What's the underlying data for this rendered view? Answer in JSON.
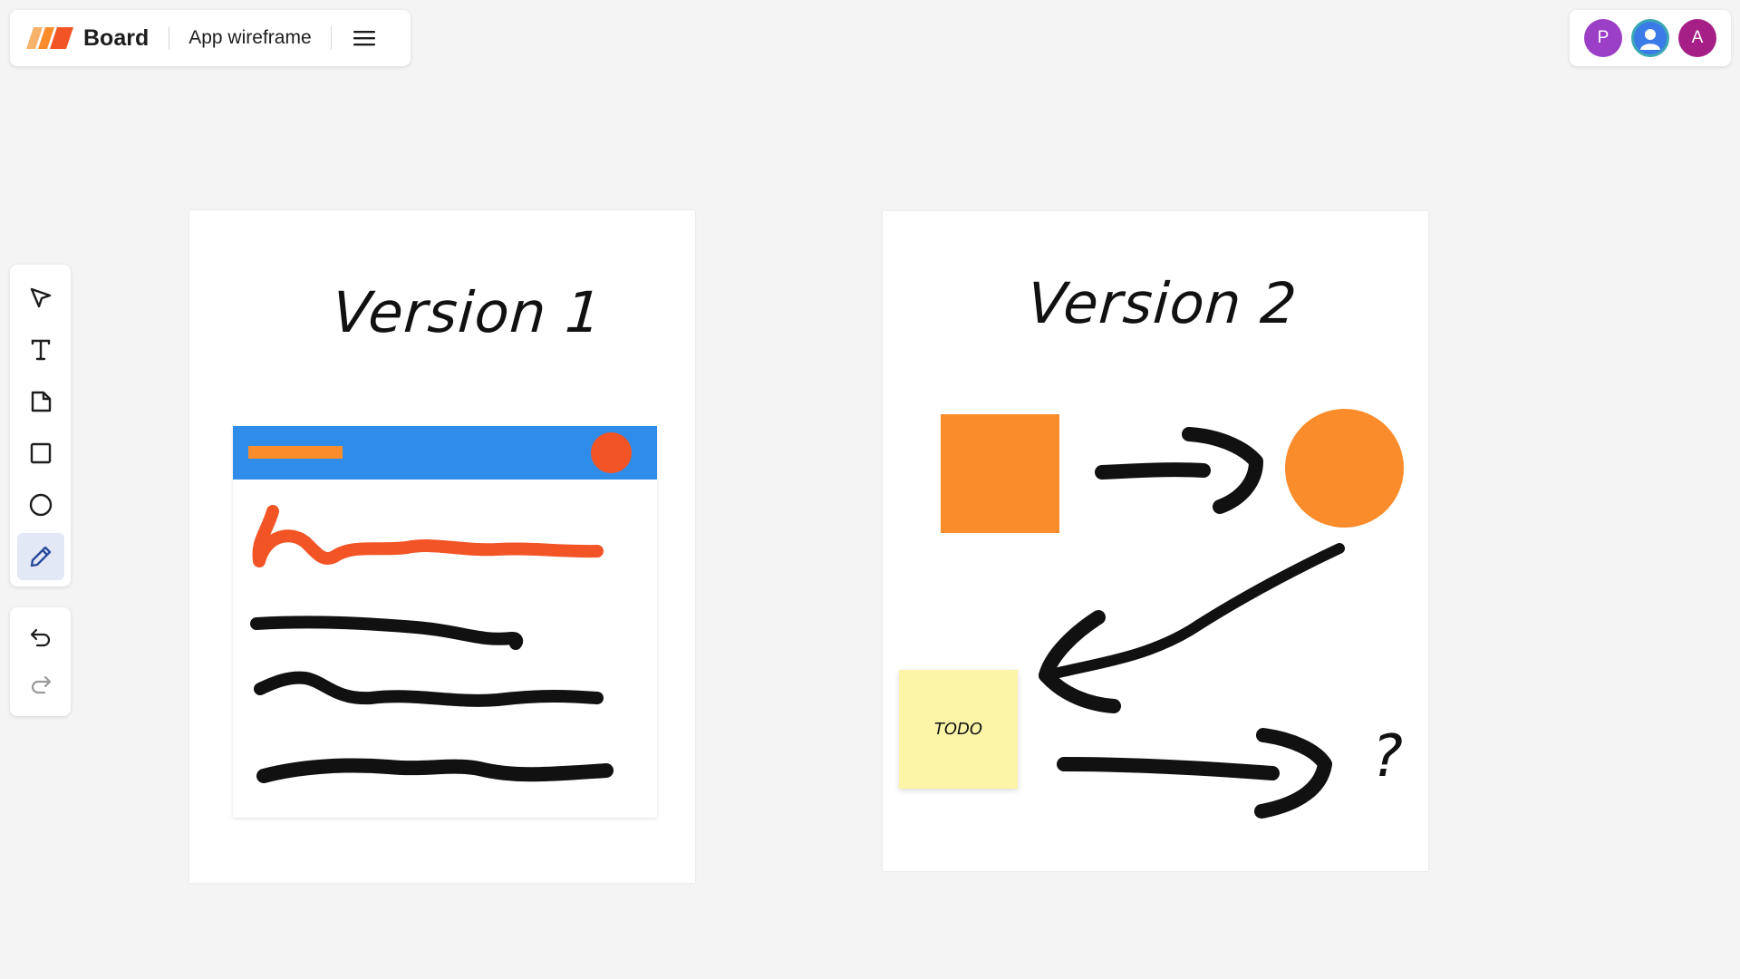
{
  "header": {
    "brand": "Board",
    "board_name": "App wireframe",
    "menu_icon": "hamburger-menu-icon"
  },
  "collaborators": [
    {
      "initial": "P",
      "color": "#9b3fc7"
    },
    {
      "initial": "",
      "color": "#3b7be8",
      "icon": "user-icon"
    },
    {
      "initial": "A",
      "color": "#a61f86"
    }
  ],
  "toolbar": {
    "tools": [
      {
        "name": "select",
        "icon": "pointer-icon",
        "active": false
      },
      {
        "name": "text",
        "icon": "text-icon",
        "active": false
      },
      {
        "name": "sticky-note",
        "icon": "sticky-note-icon",
        "active": false
      },
      {
        "name": "rectangle",
        "icon": "square-icon",
        "active": false
      },
      {
        "name": "ellipse",
        "icon": "circle-icon",
        "active": false
      },
      {
        "name": "pen",
        "icon": "pencil-icon",
        "active": true
      }
    ],
    "history": [
      {
        "name": "undo",
        "icon": "undo-icon"
      },
      {
        "name": "redo",
        "icon": "redo-icon"
      }
    ]
  },
  "canvas": {
    "frame1": {
      "title": "Version 1"
    },
    "frame2": {
      "title": "Version 2",
      "sticky_text": "TODO",
      "question": "?"
    }
  },
  "colors": {
    "blue": "#2f8ce8",
    "orange": "#fb8c2b",
    "red_orange": "#f25426",
    "sticky_yellow": "#fcf5a8",
    "active_tool_bg": "#e3e8f7"
  }
}
